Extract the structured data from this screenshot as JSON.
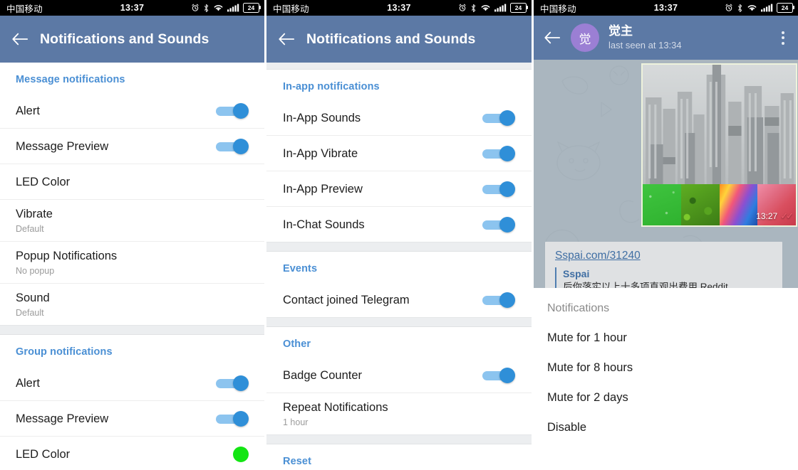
{
  "statusbar": {
    "carrier": "中国移动",
    "time": "13:37",
    "battery": "24",
    "icons": [
      "alarm-icon",
      "bluetooth-icon",
      "wifi-icon",
      "signal-icon",
      "battery-icon"
    ]
  },
  "panel1": {
    "appbar": {
      "title": "Notifications and Sounds",
      "back": "back-arrow-icon"
    },
    "sections": [
      {
        "header": "Message notifications",
        "rows": [
          {
            "title": "Alert",
            "sub": "",
            "control": "toggle",
            "on": true
          },
          {
            "title": "Message Preview",
            "sub": "",
            "control": "toggle",
            "on": true
          },
          {
            "title": "LED Color",
            "sub": "",
            "control": "none"
          },
          {
            "title": "Vibrate",
            "sub": "Default",
            "control": "none"
          },
          {
            "title": "Popup Notifications",
            "sub": "No popup",
            "control": "none"
          },
          {
            "title": "Sound",
            "sub": "Default",
            "control": "none"
          }
        ]
      },
      {
        "header": "Group notifications",
        "rows": [
          {
            "title": "Alert",
            "sub": "",
            "control": "toggle",
            "on": true
          },
          {
            "title": "Message Preview",
            "sub": "",
            "control": "toggle",
            "on": true
          },
          {
            "title": "LED Color",
            "sub": "",
            "control": "led",
            "led_color": "#13e513"
          }
        ]
      }
    ]
  },
  "panel2": {
    "appbar": {
      "title": "Notifications and Sounds",
      "back": "back-arrow-icon"
    },
    "sections": [
      {
        "header": "In-app notifications",
        "rows": [
          {
            "title": "In-App Sounds",
            "sub": "",
            "control": "toggle",
            "on": true
          },
          {
            "title": "In-App Vibrate",
            "sub": "",
            "control": "toggle",
            "on": true
          },
          {
            "title": "In-App Preview",
            "sub": "",
            "control": "toggle",
            "on": true
          },
          {
            "title": "In-Chat Sounds",
            "sub": "",
            "control": "toggle",
            "on": true
          }
        ]
      },
      {
        "header": "Events",
        "rows": [
          {
            "title": "Contact joined Telegram",
            "sub": "",
            "control": "toggle",
            "on": true
          }
        ]
      },
      {
        "header": "Other",
        "rows": [
          {
            "title": "Badge Counter",
            "sub": "",
            "control": "toggle",
            "on": true
          },
          {
            "title": "Repeat Notifications",
            "sub": "1 hour",
            "control": "none"
          }
        ]
      },
      {
        "header": "Reset",
        "rows": []
      }
    ]
  },
  "panel3": {
    "appbar": {
      "back": "back-arrow-icon",
      "avatar_initial": "觉",
      "avatar_color": "#9b7fd4",
      "name": "觉主",
      "status": "last seen at 13:34",
      "menu": "overflow-menu-icon"
    },
    "message": {
      "time": "13:27",
      "checks": "✓✓",
      "read": true
    },
    "link_preview": {
      "url": "Sspai.com/31240",
      "site": "Sspai",
      "description": "后你落实以上十多项直观出费用 Reddit"
    },
    "sheet": {
      "title": "Notifications",
      "items": [
        "Mute for 1 hour",
        "Mute for 8 hours",
        "Mute for 2 days",
        "Disable"
      ]
    }
  },
  "theme": {
    "appbar_blue": "#5c79a5",
    "section_blue": "#4a8fd4",
    "toggle_track": "#8cc4ef",
    "toggle_thumb": "#2f8fd8",
    "statusbar_black": "#000000"
  }
}
